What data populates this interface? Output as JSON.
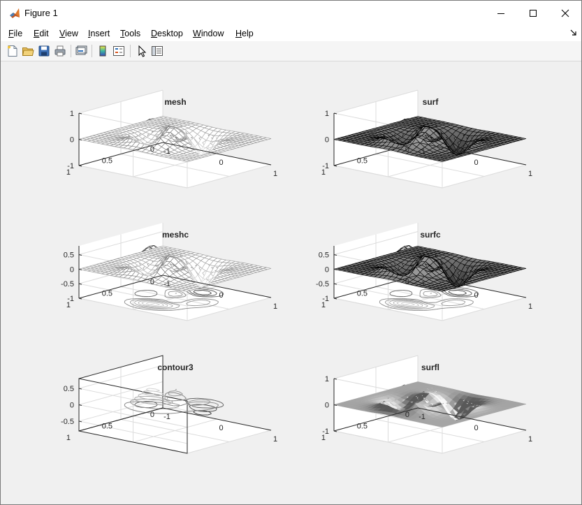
{
  "window": {
    "title": "Figure 1"
  },
  "menu": [
    {
      "label": "File",
      "key": "F",
      "rest": "ile"
    },
    {
      "label": "Edit",
      "key": "E",
      "rest": "dit"
    },
    {
      "label": "View",
      "key": "V",
      "rest": "iew"
    },
    {
      "label": "Insert",
      "key": "I",
      "rest": "nsert"
    },
    {
      "label": "Tools",
      "key": "T",
      "rest": "ools"
    },
    {
      "label": "Desktop",
      "key": "D",
      "rest": "esktop"
    },
    {
      "label": "Window",
      "key": "W",
      "rest": "indow"
    },
    {
      "label": "Help",
      "key": "H",
      "rest": "elp"
    }
  ],
  "toolbar": {
    "buttons": [
      "new-figure-icon",
      "open-file-icon",
      "save-icon",
      "print-icon",
      "link-plot-icon",
      "insert-colorbar-icon",
      "insert-legend-icon",
      "edit-plot-icon",
      "property-inspector-icon"
    ]
  },
  "colors": {
    "canvas": "#f0f0f0",
    "axis": "#262626",
    "grid": "#dcdcdc"
  },
  "chart_data": [
    {
      "type": "mesh",
      "title": "mesh",
      "z_ticks": [
        "1",
        "0",
        "-1"
      ],
      "y_ticks": [
        "1",
        "0.5",
        "0"
      ],
      "x_ticks": [
        "-1",
        "0",
        "1"
      ],
      "zlim": [
        -1,
        1
      ]
    },
    {
      "type": "surf",
      "title": "surf",
      "z_ticks": [
        "1",
        "0",
        "-1"
      ],
      "y_ticks": [
        "1",
        "0.5",
        "0"
      ],
      "x_ticks": [
        "-1",
        "0",
        "1"
      ],
      "zlim": [
        -1,
        1
      ]
    },
    {
      "type": "meshc",
      "title": "meshc",
      "z_ticks": [
        "0.5",
        "0",
        "-0.5",
        "-1"
      ],
      "y_ticks": [
        "1",
        "0.5",
        "0"
      ],
      "x_ticks": [
        "-1",
        "0",
        "1"
      ],
      "zlim": [
        -1,
        0.8
      ]
    },
    {
      "type": "surfc",
      "title": "surfc",
      "z_ticks": [
        "0.5",
        "0",
        "-0.5",
        "-1"
      ],
      "y_ticks": [
        "1",
        "0.5",
        "0"
      ],
      "x_ticks": [
        "-1",
        "0",
        "1"
      ],
      "zlim": [
        -1,
        0.8
      ]
    },
    {
      "type": "contour3",
      "title": "contour3",
      "z_ticks": [
        "0.5",
        "0",
        "-0.5"
      ],
      "y_ticks": [
        "1",
        "0.5",
        "0"
      ],
      "x_ticks": [
        "-1",
        "0",
        "1"
      ],
      "zlim": [
        -0.8,
        0.8
      ]
    },
    {
      "type": "surfl",
      "title": "surfl",
      "z_ticks": [
        "1",
        "0",
        "-1"
      ],
      "y_ticks": [
        "1",
        "0.5",
        "0"
      ],
      "x_ticks": [
        "-1",
        "0",
        "1"
      ],
      "zlim": [
        -1,
        1
      ]
    }
  ]
}
